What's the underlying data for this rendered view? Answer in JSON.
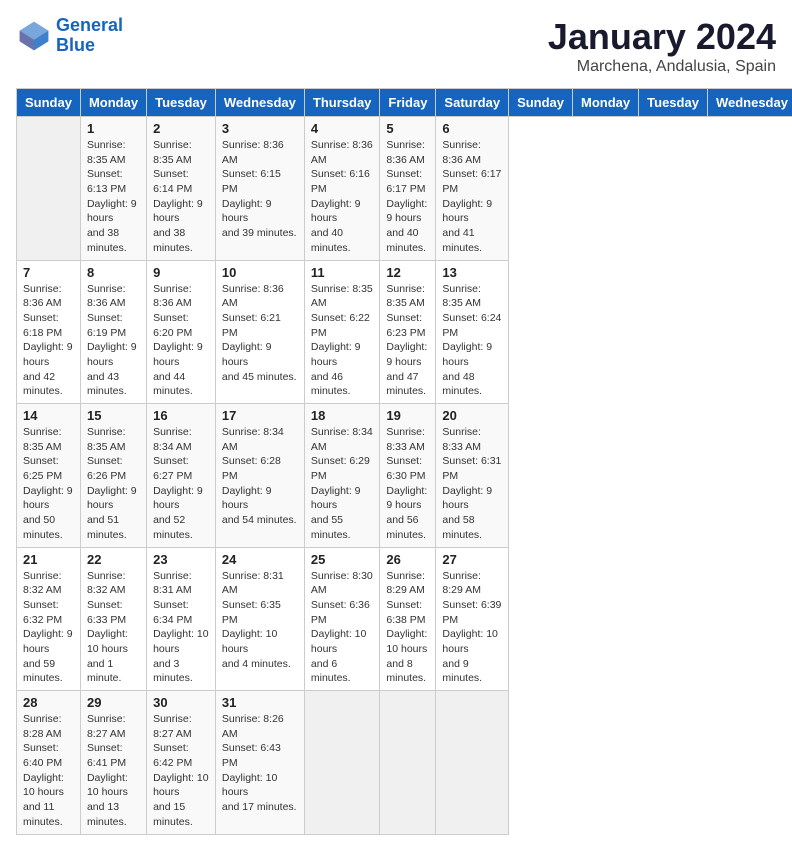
{
  "header": {
    "logo_line1": "General",
    "logo_line2": "Blue",
    "month": "January 2024",
    "location": "Marchena, Andalusia, Spain"
  },
  "days_of_week": [
    "Sunday",
    "Monday",
    "Tuesday",
    "Wednesday",
    "Thursday",
    "Friday",
    "Saturday"
  ],
  "weeks": [
    [
      {
        "day": "",
        "info": ""
      },
      {
        "day": "1",
        "info": "Sunrise: 8:35 AM\nSunset: 6:13 PM\nDaylight: 9 hours\nand 38 minutes."
      },
      {
        "day": "2",
        "info": "Sunrise: 8:35 AM\nSunset: 6:14 PM\nDaylight: 9 hours\nand 38 minutes."
      },
      {
        "day": "3",
        "info": "Sunrise: 8:36 AM\nSunset: 6:15 PM\nDaylight: 9 hours\nand 39 minutes."
      },
      {
        "day": "4",
        "info": "Sunrise: 8:36 AM\nSunset: 6:16 PM\nDaylight: 9 hours\nand 40 minutes."
      },
      {
        "day": "5",
        "info": "Sunrise: 8:36 AM\nSunset: 6:17 PM\nDaylight: 9 hours\nand 40 minutes."
      },
      {
        "day": "6",
        "info": "Sunrise: 8:36 AM\nSunset: 6:17 PM\nDaylight: 9 hours\nand 41 minutes."
      }
    ],
    [
      {
        "day": "7",
        "info": "Sunrise: 8:36 AM\nSunset: 6:18 PM\nDaylight: 9 hours\nand 42 minutes."
      },
      {
        "day": "8",
        "info": "Sunrise: 8:36 AM\nSunset: 6:19 PM\nDaylight: 9 hours\nand 43 minutes."
      },
      {
        "day": "9",
        "info": "Sunrise: 8:36 AM\nSunset: 6:20 PM\nDaylight: 9 hours\nand 44 minutes."
      },
      {
        "day": "10",
        "info": "Sunrise: 8:36 AM\nSunset: 6:21 PM\nDaylight: 9 hours\nand 45 minutes."
      },
      {
        "day": "11",
        "info": "Sunrise: 8:35 AM\nSunset: 6:22 PM\nDaylight: 9 hours\nand 46 minutes."
      },
      {
        "day": "12",
        "info": "Sunrise: 8:35 AM\nSunset: 6:23 PM\nDaylight: 9 hours\nand 47 minutes."
      },
      {
        "day": "13",
        "info": "Sunrise: 8:35 AM\nSunset: 6:24 PM\nDaylight: 9 hours\nand 48 minutes."
      }
    ],
    [
      {
        "day": "14",
        "info": "Sunrise: 8:35 AM\nSunset: 6:25 PM\nDaylight: 9 hours\nand 50 minutes."
      },
      {
        "day": "15",
        "info": "Sunrise: 8:35 AM\nSunset: 6:26 PM\nDaylight: 9 hours\nand 51 minutes."
      },
      {
        "day": "16",
        "info": "Sunrise: 8:34 AM\nSunset: 6:27 PM\nDaylight: 9 hours\nand 52 minutes."
      },
      {
        "day": "17",
        "info": "Sunrise: 8:34 AM\nSunset: 6:28 PM\nDaylight: 9 hours\nand 54 minutes."
      },
      {
        "day": "18",
        "info": "Sunrise: 8:34 AM\nSunset: 6:29 PM\nDaylight: 9 hours\nand 55 minutes."
      },
      {
        "day": "19",
        "info": "Sunrise: 8:33 AM\nSunset: 6:30 PM\nDaylight: 9 hours\nand 56 minutes."
      },
      {
        "day": "20",
        "info": "Sunrise: 8:33 AM\nSunset: 6:31 PM\nDaylight: 9 hours\nand 58 minutes."
      }
    ],
    [
      {
        "day": "21",
        "info": "Sunrise: 8:32 AM\nSunset: 6:32 PM\nDaylight: 9 hours\nand 59 minutes."
      },
      {
        "day": "22",
        "info": "Sunrise: 8:32 AM\nSunset: 6:33 PM\nDaylight: 10 hours\nand 1 minute."
      },
      {
        "day": "23",
        "info": "Sunrise: 8:31 AM\nSunset: 6:34 PM\nDaylight: 10 hours\nand 3 minutes."
      },
      {
        "day": "24",
        "info": "Sunrise: 8:31 AM\nSunset: 6:35 PM\nDaylight: 10 hours\nand 4 minutes."
      },
      {
        "day": "25",
        "info": "Sunrise: 8:30 AM\nSunset: 6:36 PM\nDaylight: 10 hours\nand 6 minutes."
      },
      {
        "day": "26",
        "info": "Sunrise: 8:29 AM\nSunset: 6:38 PM\nDaylight: 10 hours\nand 8 minutes."
      },
      {
        "day": "27",
        "info": "Sunrise: 8:29 AM\nSunset: 6:39 PM\nDaylight: 10 hours\nand 9 minutes."
      }
    ],
    [
      {
        "day": "28",
        "info": "Sunrise: 8:28 AM\nSunset: 6:40 PM\nDaylight: 10 hours\nand 11 minutes."
      },
      {
        "day": "29",
        "info": "Sunrise: 8:27 AM\nSunset: 6:41 PM\nDaylight: 10 hours\nand 13 minutes."
      },
      {
        "day": "30",
        "info": "Sunrise: 8:27 AM\nSunset: 6:42 PM\nDaylight: 10 hours\nand 15 minutes."
      },
      {
        "day": "31",
        "info": "Sunrise: 8:26 AM\nSunset: 6:43 PM\nDaylight: 10 hours\nand 17 minutes."
      },
      {
        "day": "",
        "info": ""
      },
      {
        "day": "",
        "info": ""
      },
      {
        "day": "",
        "info": ""
      }
    ]
  ]
}
